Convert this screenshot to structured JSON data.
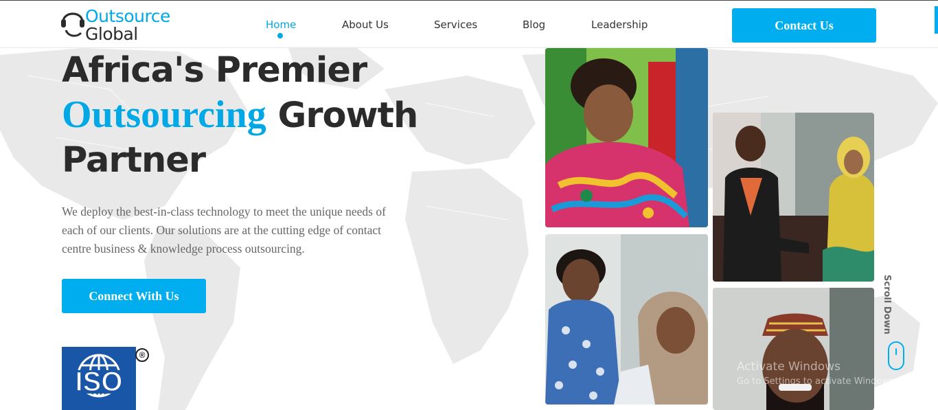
{
  "brand": {
    "line1": "Outsource",
    "line2": "Global",
    "primary_color": "#00aeef",
    "text_color": "#2b2b2b"
  },
  "nav": {
    "items": [
      {
        "label": "Home",
        "active": true
      },
      {
        "label": "About Us",
        "active": false
      },
      {
        "label": "Services",
        "active": false
      },
      {
        "label": "Blog",
        "active": false
      },
      {
        "label": "Leadership",
        "active": false
      }
    ],
    "cta_label": "Contact Us"
  },
  "hero": {
    "title_part1": "Africa's Premier",
    "title_highlight": "Outsourcing",
    "title_part2": "Growth",
    "title_part3": "Partner",
    "description": "We deploy the best-in-class technology to meet the unique needs of each of our clients. Our solutions are at the cutting edge of contact centre business & knowledge process outsourcing.",
    "cta_label": "Connect With Us"
  },
  "iso": {
    "text": "ISO",
    "registered_mark": "®"
  },
  "scroll": {
    "label": "Scroll Down"
  },
  "watermark": {
    "line1": "Activate Windows",
    "line2": "Go to Settings to activate Windows."
  },
  "icons": [
    "headset-logo-icon",
    "mouse-scroll-icon",
    "globe-icon"
  ]
}
